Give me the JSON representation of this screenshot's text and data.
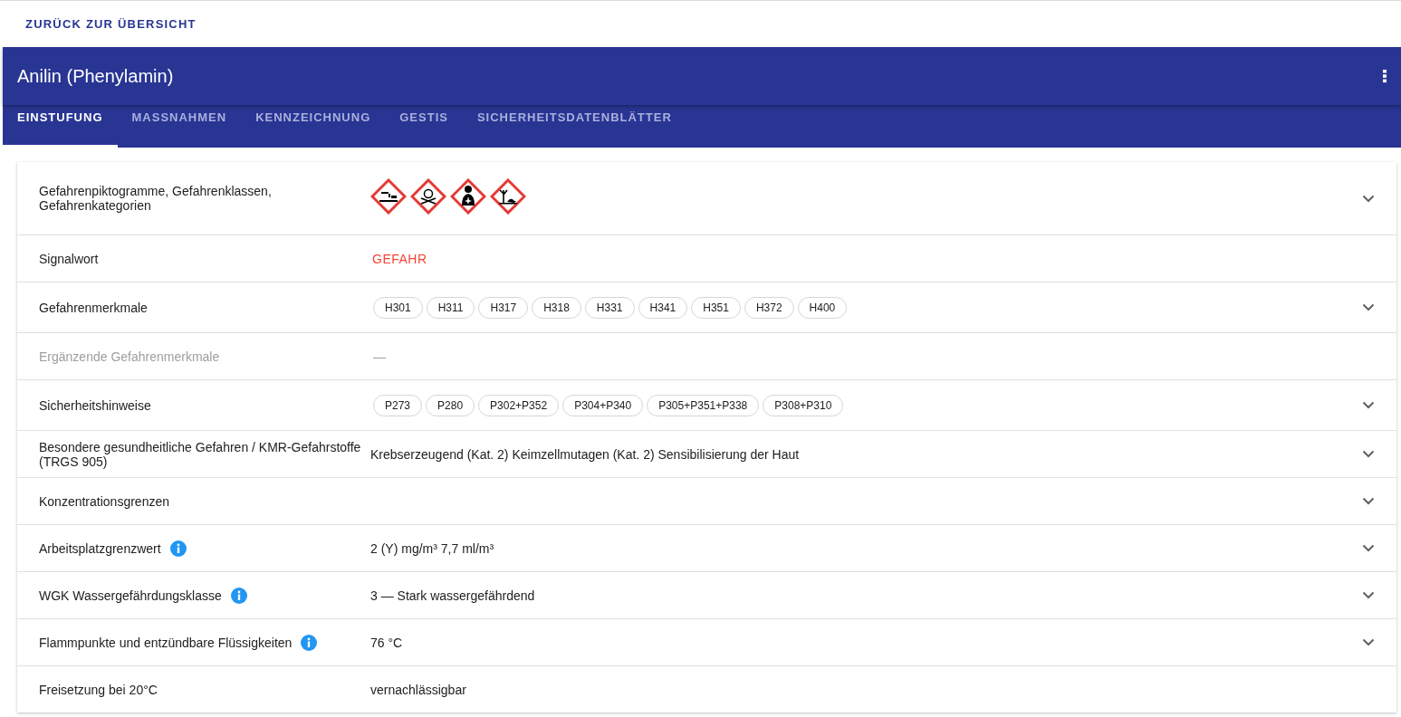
{
  "back_link": "ZURÜCK ZUR ÜBERSICHT",
  "header": {
    "title": "Anilin (Phenylamin)"
  },
  "tabs": [
    {
      "label": "EINSTUFUNG",
      "selected": true
    },
    {
      "label": "MASSNAHMEN",
      "selected": false
    },
    {
      "label": "KENNZEICHNUNG",
      "selected": false
    },
    {
      "label": "GESTIS",
      "selected": false
    },
    {
      "label": "SICHERHEITSDATENBLÄTTER",
      "selected": false
    }
  ],
  "rows": [
    {
      "label": "Gefahrenpiktogramme, Gefahrenklassen, Gefahrenkategorien",
      "kind": "pictograms",
      "pictograms": [
        {
          "kind": "corrosive"
        },
        {
          "kind": "toxic"
        },
        {
          "kind": "health"
        },
        {
          "kind": "environment"
        }
      ],
      "expandable": true,
      "info": false,
      "disabled": false
    },
    {
      "label": "Signalwort",
      "kind": "signal",
      "value": "GEFAHR",
      "expandable": false,
      "info": false,
      "disabled": false
    },
    {
      "label": "Gefahrenmerkmale",
      "kind": "chips",
      "chips": [
        "H301",
        "H311",
        "H317",
        "H318",
        "H331",
        "H341",
        "H351",
        "H372",
        "H400"
      ],
      "expandable": true,
      "info": false,
      "disabled": false
    },
    {
      "label": "Ergänzende Gefahrenmerkmale",
      "kind": "dash",
      "value": "—",
      "expandable": false,
      "info": false,
      "disabled": true
    },
    {
      "label": "Sicherheitshinweise",
      "kind": "chips",
      "chips": [
        "P273",
        "P280",
        "P302+P352",
        "P304+P340",
        "P305+P351+P338",
        "P308+P310"
      ],
      "expandable": true,
      "info": false,
      "disabled": false
    },
    {
      "label": "Besondere gesundheitliche Gefahren / KMR-Gefahrstoffe (TRGS 905)",
      "kind": "text",
      "value": "Krebserzeugend (Kat. 2) Keimzellmutagen (Kat. 2) Sensibilisierung der Haut",
      "expandable": true,
      "info": false,
      "disabled": false
    },
    {
      "label": "Konzentrationsgrenzen",
      "kind": "empty",
      "expandable": true,
      "info": false,
      "disabled": false
    },
    {
      "label": "Arbeitsplatzgrenzwert",
      "kind": "text",
      "value": "2 (Y) mg/m³ 7,7 ml/m³",
      "expandable": true,
      "info": true,
      "disabled": false
    },
    {
      "label": "WGK Wassergefährdungsklasse",
      "kind": "text",
      "value": "3 — Stark wassergefährdend",
      "expandable": true,
      "info": true,
      "disabled": false
    },
    {
      "label": "Flammpunkte und entzündbare Flüssigkeiten",
      "kind": "text",
      "value": "76 °C",
      "expandable": true,
      "info": true,
      "disabled": false
    },
    {
      "label": "Freisetzung bei 20°C",
      "kind": "text",
      "value": "vernachlässigbar",
      "expandable": false,
      "info": false,
      "disabled": false
    }
  ]
}
